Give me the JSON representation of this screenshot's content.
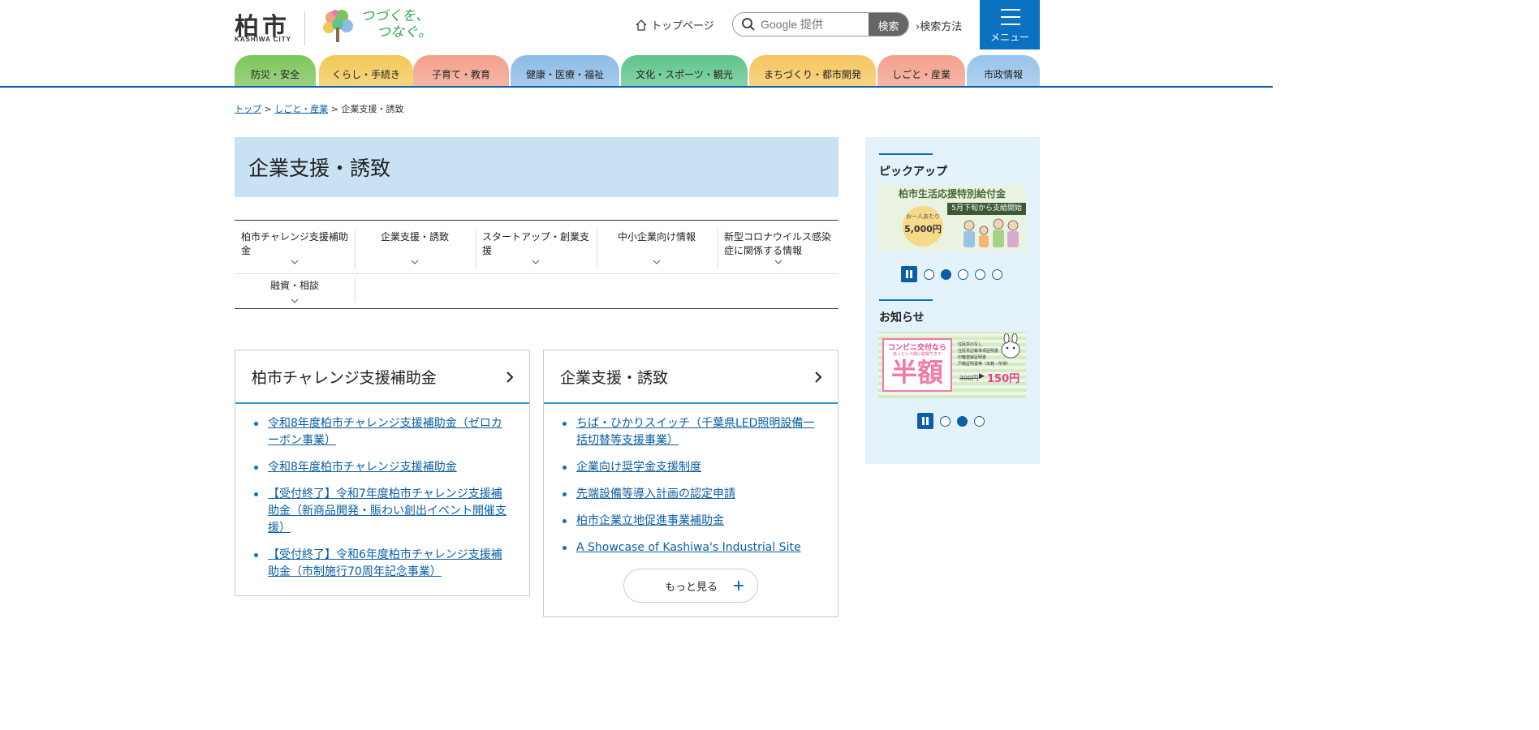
{
  "header": {
    "logo_kanji": "柏市",
    "logo_roman": "KASHIWA CITY",
    "slogan_line1": "つづくを、",
    "slogan_line2": "つなぐ。",
    "top_page_label": "トップページ",
    "search_placeholder": "Google 提供",
    "search_button": "検索",
    "search_method_label": "検索方法",
    "menu_label": "メニュー"
  },
  "nav": {
    "tabs": [
      {
        "label": "防災・安全",
        "color": "#7dc55a"
      },
      {
        "label": "くらし・手続き",
        "color": "#f2c957"
      },
      {
        "label": "子育て・教育",
        "color": "#f2a08a"
      },
      {
        "label": "健康・医療・福祉",
        "color": "#8dbbe6"
      },
      {
        "label": "文化・スポーツ・観光",
        "color": "#5fc48c"
      },
      {
        "label": "まちづくり・都市開発",
        "color": "#f5c65e"
      },
      {
        "label": "しごと・産業",
        "color": "#f3a08c"
      },
      {
        "label": "市政情報",
        "color": "#98c3ea"
      }
    ]
  },
  "breadcrumb": {
    "top": "トップ",
    "sep": ">",
    "parent": "しごと・産業",
    "current": "企業支援・誘致"
  },
  "page_title": "企業支援・誘致",
  "subcategories": [
    "柏市チャレンジ支援補助金",
    "企業支援・誘致",
    "スタートアップ・創業支援",
    "中小企業向け情報",
    "新型コロナウイルス感染症に関係する情報",
    "融資・相談"
  ],
  "cards": [
    {
      "title": "柏市チャレンジ支援補助金",
      "links": [
        "令和8年度柏市チャレンジ支援補助金（ゼロカーボン事業）",
        "令和8年度柏市チャレンジ支援補助金",
        "【受付終了】令和7年度柏市チャレンジ支援補助金（新商品開発・賑わい創出イベント開催支援）",
        "【受付終了】令和6年度柏市チャレンジ支援補助金（市制施行70周年記念事業）"
      ]
    },
    {
      "title": "企業支援・誘致",
      "links": [
        "ちば・ひかりスイッチ（千葉県LED照明設備一括切替等支援事業）",
        "企業向け奨学金支援制度",
        "先端設備等導入計画の認定申請",
        "柏市企業立地促進事業補助金",
        "A Showcase of Kashiwa's Industrial Site"
      ],
      "more_label": "もっと見る"
    }
  ],
  "sidebar": {
    "pickup_heading": "ピックアップ",
    "pickup_banner": {
      "title": "柏市生活応援特別給付金",
      "subtitle": "5月下旬から支給開始",
      "amount_label": "お一人あたり",
      "amount": "5,000円"
    },
    "pickup_dots": 5,
    "pickup_active": 2,
    "news_heading": "お知らせ",
    "news_banner": {
      "line1": "コンビニ交付なら",
      "line2": "あっという間に取得できて",
      "big": "半額",
      "old_price": "300円",
      "new_price": "150円",
      "items": [
        "住民票の写し",
        "住民票記載事項証明書",
        "印鑑登録証明書",
        "戸籍証明書等（本籍・所得）"
      ]
    },
    "news_dots": 3,
    "news_active": 2
  },
  "colors": {
    "accent": "#0b72c2",
    "link": "#0b5fa5",
    "title_bg": "#c8e2f3",
    "sidebar_bg": "#e4f3fb"
  }
}
